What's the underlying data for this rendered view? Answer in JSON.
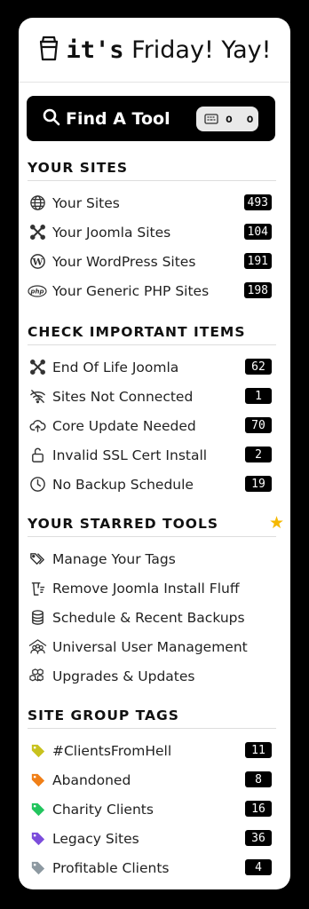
{
  "header": {
    "title_bold": "it's",
    "title_rest": "Friday! Yay!",
    "icon": "cup-icon"
  },
  "find_tool": {
    "label": "Find A Tool",
    "shortcut": "o o",
    "icon": "search-icon"
  },
  "sections": {
    "your_sites": {
      "title": "YOUR SITES",
      "items": [
        {
          "label": "Your Sites",
          "count": "493",
          "icon": "globe-icon"
        },
        {
          "label": "Your Joomla Sites",
          "count": "104",
          "icon": "joomla-icon"
        },
        {
          "label": "Your WordPress Sites",
          "count": "191",
          "icon": "wordpress-icon"
        },
        {
          "label": "Your Generic PHP Sites",
          "count": "198",
          "icon": "php-icon"
        }
      ]
    },
    "important": {
      "title": "CHECK IMPORTANT ITEMS",
      "items": [
        {
          "label": "End Of Life Joomla",
          "count": "62",
          "icon": "joomla-icon"
        },
        {
          "label": "Sites Not Connected",
          "count": "1",
          "icon": "wifi-off-icon"
        },
        {
          "label": "Core Update Needed",
          "count": "70",
          "icon": "cloud-upload-icon"
        },
        {
          "label": "Invalid SSL Cert Install",
          "count": "2",
          "icon": "unlock-icon"
        },
        {
          "label": "No Backup Schedule",
          "count": "19",
          "icon": "clock-icon"
        }
      ]
    },
    "starred": {
      "title": "YOUR STARRED TOOLS",
      "items": [
        {
          "label": "Manage Your Tags",
          "icon": "tags-icon"
        },
        {
          "label": "Remove Joomla Install Fluff",
          "icon": "trash-icon"
        },
        {
          "label": "Schedule & Recent Backups",
          "icon": "database-icon"
        },
        {
          "label": "Universal User Management",
          "icon": "users-icon"
        },
        {
          "label": "Upgrades & Updates",
          "icon": "boxes-icon"
        }
      ]
    },
    "tags": {
      "title": "SITE GROUP TAGS",
      "items": [
        {
          "label": "#ClientsFromHell",
          "count": "11",
          "color": "#c8c21e"
        },
        {
          "label": "Abandoned",
          "count": "8",
          "color": "#f07f17"
        },
        {
          "label": "Charity Clients",
          "count": "16",
          "color": "#22c55e"
        },
        {
          "label": "Legacy Sites",
          "count": "36",
          "color": "#7c4ddb"
        },
        {
          "label": "Profitable Clients",
          "count": "4",
          "color": "#8d99a1"
        }
      ]
    }
  }
}
